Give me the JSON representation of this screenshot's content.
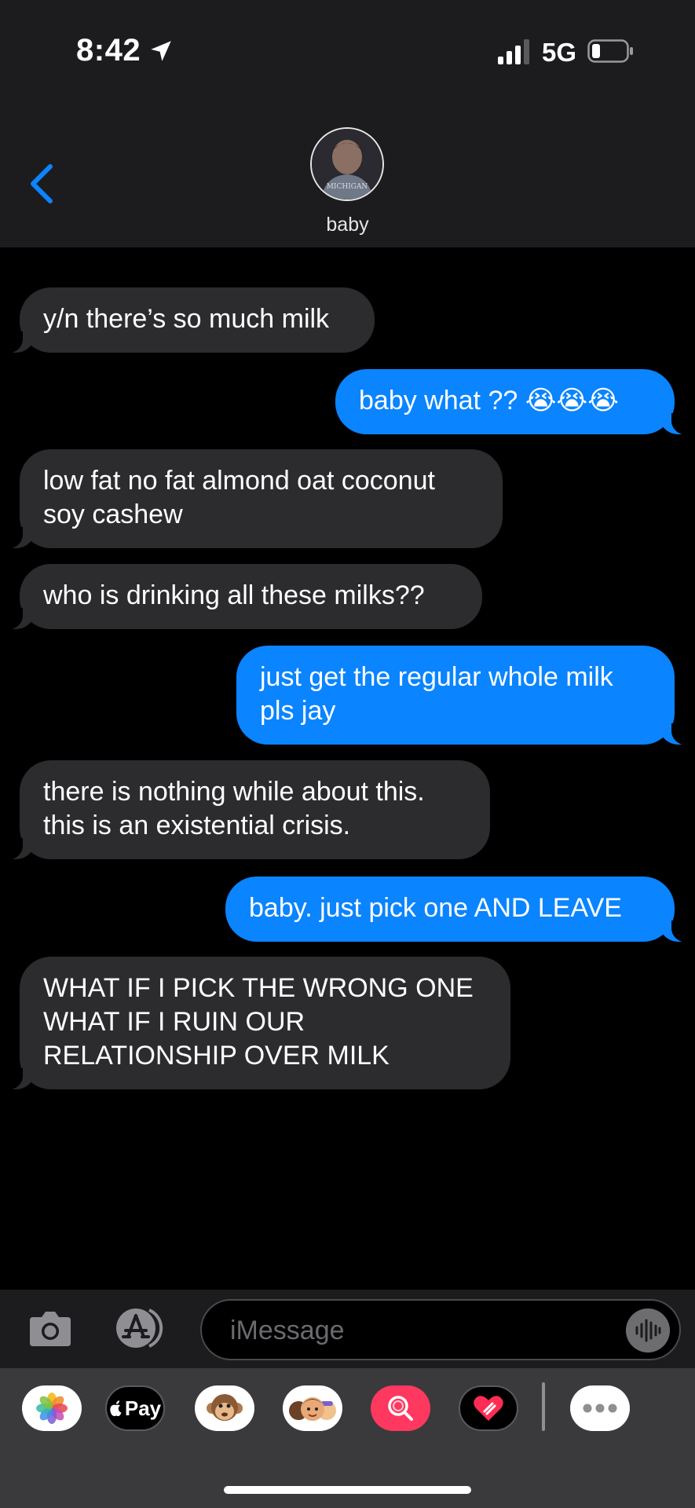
{
  "status_bar": {
    "time": "8:42",
    "network": "5G"
  },
  "header": {
    "contact_name": "baby"
  },
  "messages": [
    {
      "from": "them",
      "text": "y/n there’s so much milk"
    },
    {
      "from": "me",
      "text": "baby what ?? 😭😭😭"
    },
    {
      "from": "them",
      "text": "low fat no fat almond oat coconut\nsoy cashew"
    },
    {
      "from": "them",
      "text": "who is drinking all these milks??"
    },
    {
      "from": "me",
      "text": "just get the regular whole milk\npls jay"
    },
    {
      "from": "them",
      "text": "there is nothing while about this.\nthis is an existential crisis."
    },
    {
      "from": "me",
      "text": "baby. just pick one AND LEAVE"
    },
    {
      "from": "them",
      "text": "WHAT IF I PICK THE WRONG ONE\nWHAT IF I RUIN OUR\nRELATIONSHIP OVER MILK"
    }
  ],
  "input": {
    "placeholder": "iMessage"
  },
  "app_drawer": {
    "items": [
      {
        "name": "photos-icon"
      },
      {
        "name": "apple-pay",
        "label": "Pay"
      },
      {
        "name": "animoji-monkey-icon"
      },
      {
        "name": "memoji-icon"
      },
      {
        "name": "image-search-icon"
      },
      {
        "name": "digital-touch-icon"
      },
      {
        "name": "more-icon"
      }
    ]
  },
  "colors": {
    "outgoing": "#0a84ff",
    "incoming": "#2c2c2e",
    "header": "#1c1c1e"
  }
}
